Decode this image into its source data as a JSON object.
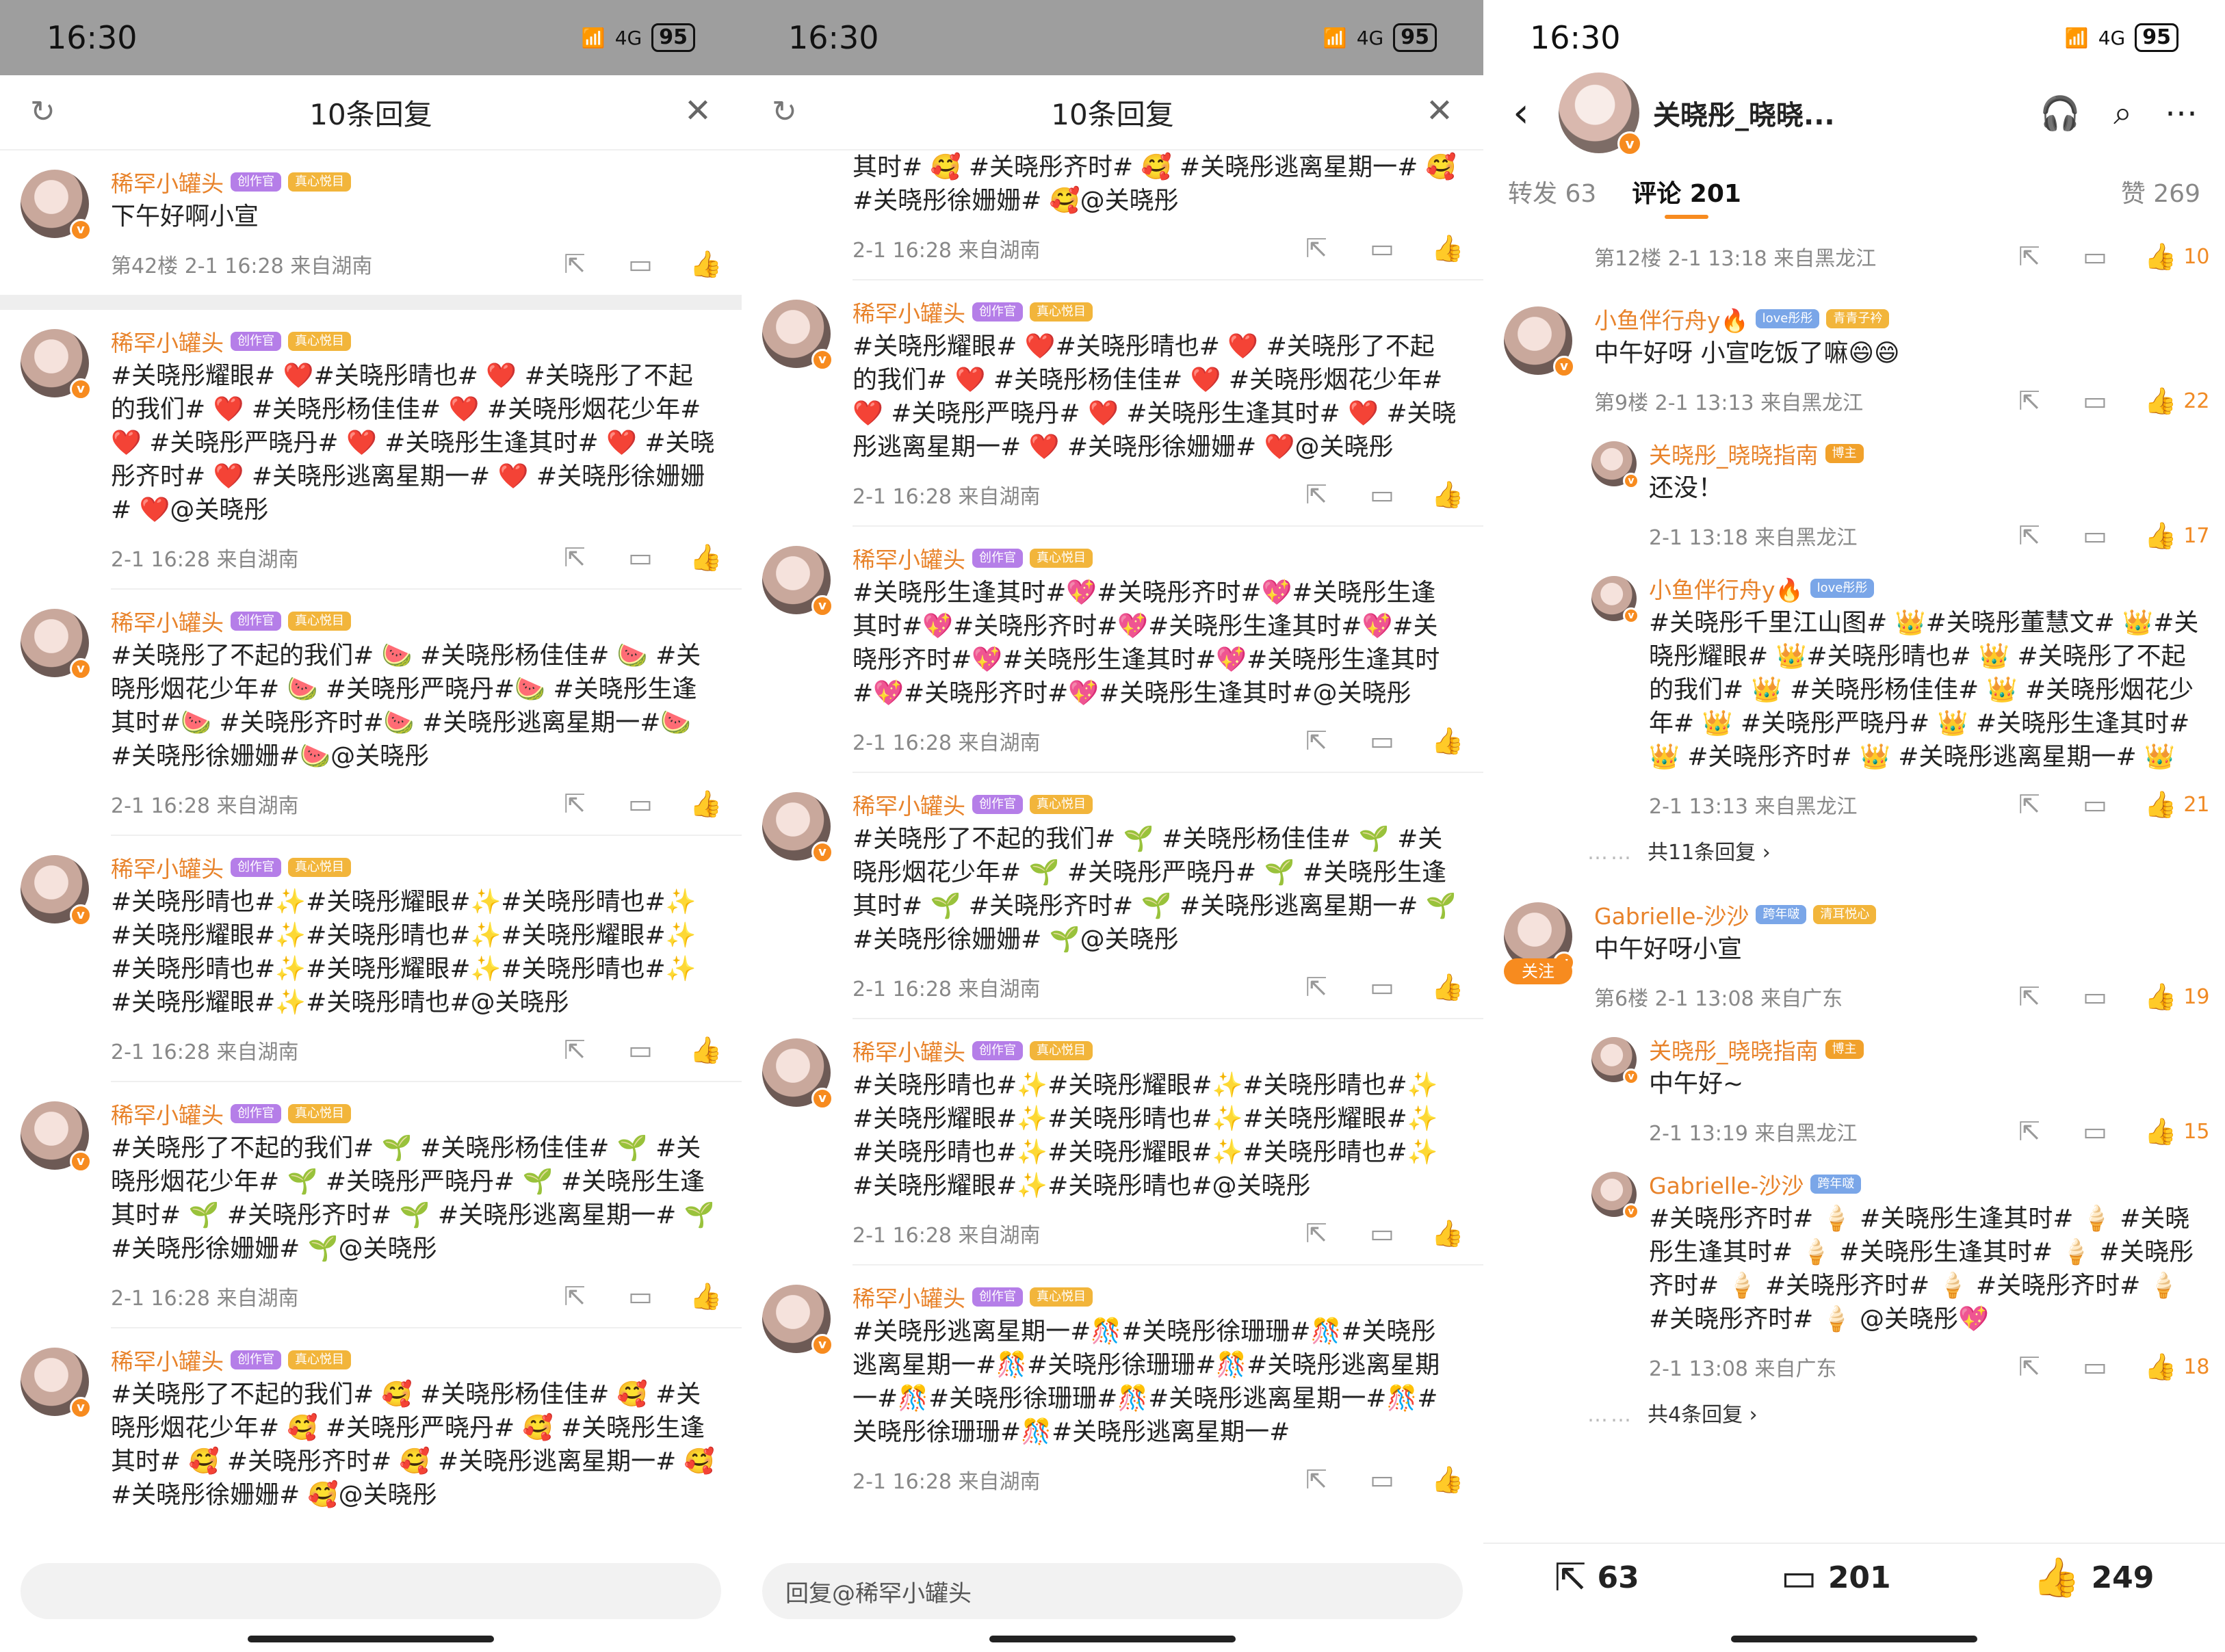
{
  "status": {
    "time": "16:30",
    "signal": "4G",
    "battery": "95"
  },
  "sheet": {
    "title": "10条回复"
  },
  "badges": {
    "creator": "创作官",
    "fan": "真心悦目"
  },
  "panel1": {
    "top_item": {
      "user": "稀罕小罐头",
      "content": "下午好啊小宣",
      "meta": "第42楼 2-1 16:28 来自湖南"
    },
    "items": [
      {
        "user": "稀罕小罐头",
        "content": "#关晓彤耀眼# ❤️#关晓彤晴也# ❤️ #关晓彤了不起的我们# ❤️ #关晓彤杨佳佳# ❤️ #关晓彤烟花少年# ❤️ #关晓彤严晓丹# ❤️ #关晓彤生逢其时# ❤️ #关晓彤齐时# ❤️ #关晓彤逃离星期一# ❤️ #关晓彤徐姗姗# ❤️@关晓彤",
        "meta": "2-1 16:28 来自湖南"
      },
      {
        "user": "稀罕小罐头",
        "content": "#关晓彤了不起的我们# 🍉 #关晓彤杨佳佳# 🍉 #关晓彤烟花少年# 🍉 #关晓彤严晓丹#🍉 #关晓彤生逢其时#🍉 #关晓彤齐时#🍉 #关晓彤逃离星期一#🍉 #关晓彤徐姗姗#🍉@关晓彤",
        "meta": "2-1 16:28 来自湖南"
      },
      {
        "user": "稀罕小罐头",
        "content": "#关晓彤晴也#✨#关晓彤耀眼#✨#关晓彤晴也#✨#关晓彤耀眼#✨#关晓彤晴也#✨#关晓彤耀眼#✨#关晓彤晴也#✨#关晓彤耀眼#✨#关晓彤晴也#✨#关晓彤耀眼#✨#关晓彤晴也#@关晓彤",
        "meta": "2-1 16:28 来自湖南"
      },
      {
        "user": "稀罕小罐头",
        "content": "#关晓彤了不起的我们# 🌱 #关晓彤杨佳佳# 🌱 #关晓彤烟花少年# 🌱 #关晓彤严晓丹# 🌱 #关晓彤生逢其时# 🌱 #关晓彤齐时# 🌱 #关晓彤逃离星期一# 🌱 #关晓彤徐姗姗# 🌱@关晓彤",
        "meta": "2-1 16:28 来自湖南"
      },
      {
        "user": "稀罕小罐头",
        "content": "#关晓彤了不起的我们# 🥰 #关晓彤杨佳佳# 🥰 #关晓彤烟花少年# 🥰 #关晓彤严晓丹# 🥰 #关晓彤生逢其时# 🥰 #关晓彤齐时# 🥰 #关晓彤逃离星期一# 🥰 #关晓彤徐姗姗# 🥰@关晓彤",
        "meta": ""
      }
    ],
    "input_placeholder": ""
  },
  "panel2": {
    "top_content": "其时# 🥰 #关晓彤齐时# 🥰 #关晓彤逃离星期一# 🥰 #关晓彤徐姗姗# 🥰@关晓彤",
    "top_meta": "2-1 16:28 来自湖南",
    "items": [
      {
        "user": "稀罕小罐头",
        "content": "#关晓彤耀眼# ❤️#关晓彤晴也# ❤️ #关晓彤了不起的我们# ❤️ #关晓彤杨佳佳# ❤️ #关晓彤烟花少年# ❤️ #关晓彤严晓丹# ❤️ #关晓彤生逢其时# ❤️ #关晓彤逃离星期一# ❤️ #关晓彤徐姗姗# ❤️@关晓彤",
        "meta": "2-1 16:28 来自湖南"
      },
      {
        "user": "稀罕小罐头",
        "content": "#关晓彤生逢其时#💖#关晓彤齐时#💖#关晓彤生逢其时#💖#关晓彤齐时#💖#关晓彤生逢其时#💖#关晓彤齐时#💖#关晓彤生逢其时#💖#关晓彤生逢其时#💖#关晓彤齐时#💖#关晓彤生逢其时#@关晓彤",
        "meta": "2-1 16:28 来自湖南"
      },
      {
        "user": "稀罕小罐头",
        "content": "#关晓彤了不起的我们# 🌱 #关晓彤杨佳佳# 🌱 #关晓彤烟花少年# 🌱 #关晓彤严晓丹# 🌱 #关晓彤生逢其时# 🌱 #关晓彤齐时# 🌱 #关晓彤逃离星期一# 🌱 #关晓彤徐姗姗# 🌱@关晓彤",
        "meta": "2-1 16:28 来自湖南"
      },
      {
        "user": "稀罕小罐头",
        "content": "#关晓彤晴也#✨#关晓彤耀眼#✨#关晓彤晴也#✨#关晓彤耀眼#✨#关晓彤晴也#✨#关晓彤耀眼#✨#关晓彤晴也#✨#关晓彤耀眼#✨#关晓彤晴也#✨#关晓彤耀眼#✨#关晓彤晴也#@关晓彤",
        "meta": "2-1 16:28 来自湖南"
      },
      {
        "user": "稀罕小罐头",
        "content": "#关晓彤逃离星期一#🎊#关晓彤徐珊珊#🎊#关晓彤逃离星期一#🎊#关晓彤徐珊珊#🎊#关晓彤逃离星期一#🎊#关晓彤徐珊珊#🎊#关晓彤逃离星期一#🎊#关晓彤徐珊珊#🎊#关晓彤逃离星期一#",
        "meta": "2-1 16:28 来自湖南"
      }
    ],
    "input_placeholder": "回复@稀罕小罐头"
  },
  "panel3": {
    "nav": {
      "name": "关晓彤_晓晓..."
    },
    "tabs": {
      "repost": "转发 63",
      "comments": "评论 201",
      "likes": "赞 269"
    },
    "top_meta": {
      "text": "第12楼 2-1 13:18 来自黑龙江",
      "likes": "10"
    },
    "threads": [
      {
        "user": "小鱼伴行舟y🔥",
        "badges": [
          "love彤彤",
          "青青子衿"
        ],
        "content": "中午好呀 小宣吃饭了嘛😄😄",
        "meta": "第9楼 2-1 13:13 来自黑龙江",
        "likes": "22",
        "replies": [
          {
            "user": "关晓彤_晓晓指南",
            "badge": "博主",
            "content": "还没！",
            "meta": "2-1 13:18 来自黑龙江",
            "likes": "17"
          },
          {
            "user": "小鱼伴行舟y🔥",
            "badge": "love彤彤",
            "content": "#关晓彤千里江山图# 👑#关晓彤董慧文# 👑#关晓彤耀眼# 👑#关晓彤晴也# 👑 #关晓彤了不起的我们# 👑 #关晓彤杨佳佳# 👑 #关晓彤烟花少年# 👑 #关晓彤严晓丹# 👑 #关晓彤生逢其时# 👑 #关晓彤齐时# 👑 #关晓彤逃离星期一# 👑",
            "meta": "2-1 13:13 来自黑龙江",
            "likes": "21"
          }
        ],
        "more": "共11条回复 ›"
      },
      {
        "user": "Gabrielle-沙沙",
        "badges": [
          "跨年啵",
          "清耳悦心"
        ],
        "follow": "关注",
        "content": "中午好呀小宣",
        "meta": "第6楼 2-1 13:08 来自广东",
        "likes": "19",
        "replies": [
          {
            "user": "关晓彤_晓晓指南",
            "badge": "博主",
            "content": "中午好~",
            "meta": "2-1 13:19 来自黑龙江",
            "likes": "15"
          },
          {
            "user": "Gabrielle-沙沙",
            "badge": "跨年啵",
            "content": "#关晓彤齐时# 🍦 #关晓彤生逢其时# 🍦 #关晓彤生逢其时# 🍦 #关晓彤生逢其时# 🍦 #关晓彤齐时# 🍦 #关晓彤齐时# 🍦 #关晓彤齐时# 🍦 #关晓彤齐时# 🍦 @关晓彤💖",
            "meta": "2-1 13:08 来自广东",
            "likes": "18"
          }
        ],
        "more": "共4条回复 ›"
      }
    ],
    "bottom": {
      "reposts": "63",
      "comments": "201",
      "likes": "249"
    }
  },
  "icons": {
    "refresh": "refresh-icon",
    "close": "close-icon",
    "share": "share-icon",
    "comment": "comment-icon",
    "like": "like-icon"
  },
  "colors": {
    "username": "#e8832b",
    "accent": "#f78b1f",
    "overlay": "#9e9e9e"
  }
}
